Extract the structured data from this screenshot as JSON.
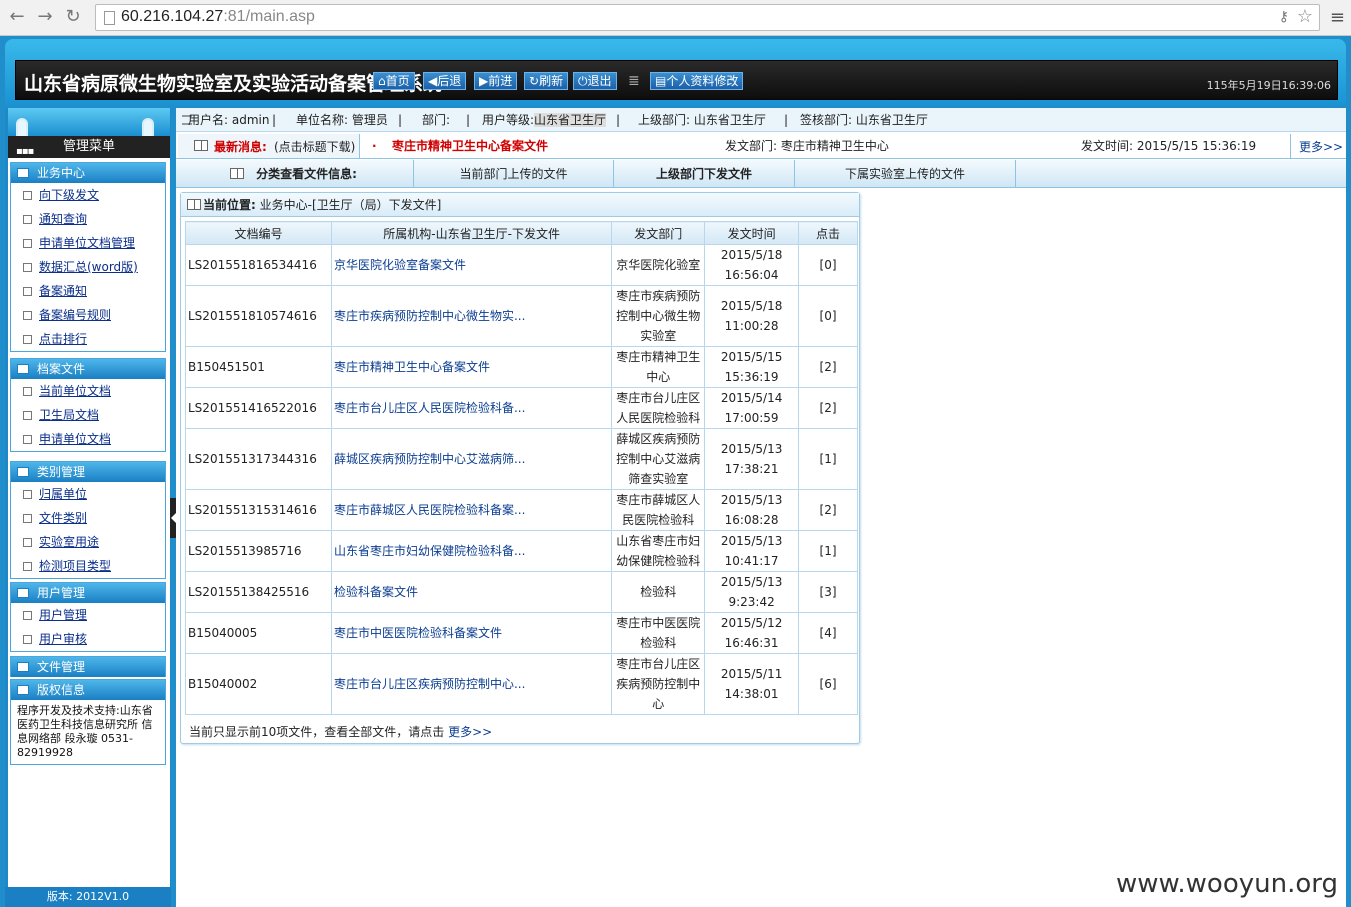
{
  "browser": {
    "url_host": "60.216.104.27",
    "url_rest": ":81/main.asp"
  },
  "header": {
    "title": "山东省病原微生物实验室及实验活动备案管理系统",
    "buttons": [
      {
        "label": "首页",
        "icon": "home-icon"
      },
      {
        "label": "后退",
        "icon": "back-arrow-icon"
      },
      {
        "label": "前进",
        "icon": "forward-arrow-icon"
      },
      {
        "label": "刷新",
        "icon": "refresh-icon"
      },
      {
        "label": "退出",
        "icon": "power-icon"
      }
    ],
    "profile_button": "个人资料修改",
    "clock": "115年5月19日16:39:06"
  },
  "userbar": {
    "username": "用户名: admin",
    "unit": "单位名称: 管理员",
    "dept": "部门:",
    "level_label": "用户等级:",
    "level_value": "山东省卫生厅",
    "parent": "上级部门: 山东省卫生厅",
    "sign": "签核部门: 山东省卫生厅"
  },
  "news": {
    "label": "最新消息:",
    "hint": "(点击标题下载)",
    "dot": "·",
    "file": "枣庄市精神卫生中心备案文件",
    "dept": "发文部门: 枣庄市精神卫生中心",
    "time": "发文时间: 2015/5/15 15:36:19",
    "more": "更多>>"
  },
  "tabs": {
    "title": "分类查看文件信息:",
    "items": [
      "当前部门上传的文件",
      "上级部门下发文件",
      "下属实验室上传的文件"
    ]
  },
  "sidebar": {
    "menu_title": "管理菜单",
    "groups": [
      {
        "title": "业务中心",
        "items": [
          "向下级发文",
          "通知查询",
          "申请单位文档管理",
          "数据汇总(word版)",
          "备案通知",
          "备案编号规则",
          "点击排行"
        ]
      },
      {
        "title": "档案文件",
        "items": [
          "当前单位文档",
          "卫生局文档",
          "申请单位文档"
        ]
      },
      {
        "title": "类别管理",
        "items": [
          "归属单位",
          "文件类别",
          "实验室用途",
          "检测项目类型"
        ]
      },
      {
        "title": "用户管理",
        "items": [
          "用户管理",
          "用户审核"
        ]
      },
      {
        "title": "文件管理",
        "items": []
      },
      {
        "title": "版权信息",
        "items": []
      }
    ],
    "copyright": "程序开发及技术支持:山东省医药卫生科技信息研究所 信息网络部 段永璇 0531-82919928",
    "version": "版本: 2012V1.0"
  },
  "panel": {
    "location_label": "当前位置:",
    "location_path": "业务中心-[卫生厅（局）下发文件]",
    "columns": [
      "文档编号",
      "所属机构-山东省卫生厅-下发文件",
      "发文部门",
      "发文时间",
      "点击"
    ],
    "rows": [
      {
        "id": "LS201551816534416",
        "file": "京华医院化验室备案文件",
        "dept": "京华医院化验室",
        "date": "2015/5/18",
        "time": "16:56:04",
        "clicks": "[0]"
      },
      {
        "id": "LS201551810574616",
        "file": "枣庄市疾病预防控制中心微生物实...",
        "dept": "枣庄市疾病预防控制中心微生物实验室",
        "date": "2015/5/18",
        "time": "11:00:28",
        "clicks": "[0]"
      },
      {
        "id": "B150451501",
        "file": "枣庄市精神卫生中心备案文件",
        "dept": "枣庄市精神卫生中心",
        "date": "2015/5/15",
        "time": "15:36:19",
        "clicks": "[2]"
      },
      {
        "id": "LS201551416522016",
        "file": "枣庄市台儿庄区人民医院检验科备...",
        "dept": "枣庄市台儿庄区人民医院检验科",
        "date": "2015/5/14",
        "time": "17:00:59",
        "clicks": "[2]"
      },
      {
        "id": "LS201551317344316",
        "file": "薛城区疾病预防控制中心艾滋病筛...",
        "dept": "薛城区疾病预防控制中心艾滋病筛查实验室",
        "date": "2015/5/13",
        "time": "17:38:21",
        "clicks": "[1]"
      },
      {
        "id": "LS201551315314616",
        "file": "枣庄市薛城区人民医院检验科备案...",
        "dept": "枣庄市薛城区人民医院检验科",
        "date": "2015/5/13",
        "time": "16:08:28",
        "clicks": "[2]"
      },
      {
        "id": "LS2015513985716",
        "file": "山东省枣庄市妇幼保健院检验科备...",
        "dept": "山东省枣庄市妇幼保健院检验科",
        "date": "2015/5/13",
        "time": "10:41:17",
        "clicks": "[1]"
      },
      {
        "id": "LS20155138425516",
        "file": "检验科备案文件",
        "dept": "检验科",
        "date": "2015/5/13",
        "time": "9:23:42",
        "clicks": "[3]"
      },
      {
        "id": "B15040005",
        "file": "枣庄市中医医院检验科备案文件",
        "dept": "枣庄市中医医院检验科",
        "date": "2015/5/12",
        "time": "16:46:31",
        "clicks": "[4]"
      },
      {
        "id": "B15040002",
        "file": "枣庄市台儿庄区疾病预防控制中心...",
        "dept": "枣庄市台儿庄区疾病预防控制中心",
        "date": "2015/5/11",
        "time": "14:38:01",
        "clicks": "[6]"
      }
    ],
    "footer_text": "当前只显示前10项文件，查看全部文件，请点击",
    "footer_more": "更多>>"
  },
  "watermark": "www.wooyun.org"
}
